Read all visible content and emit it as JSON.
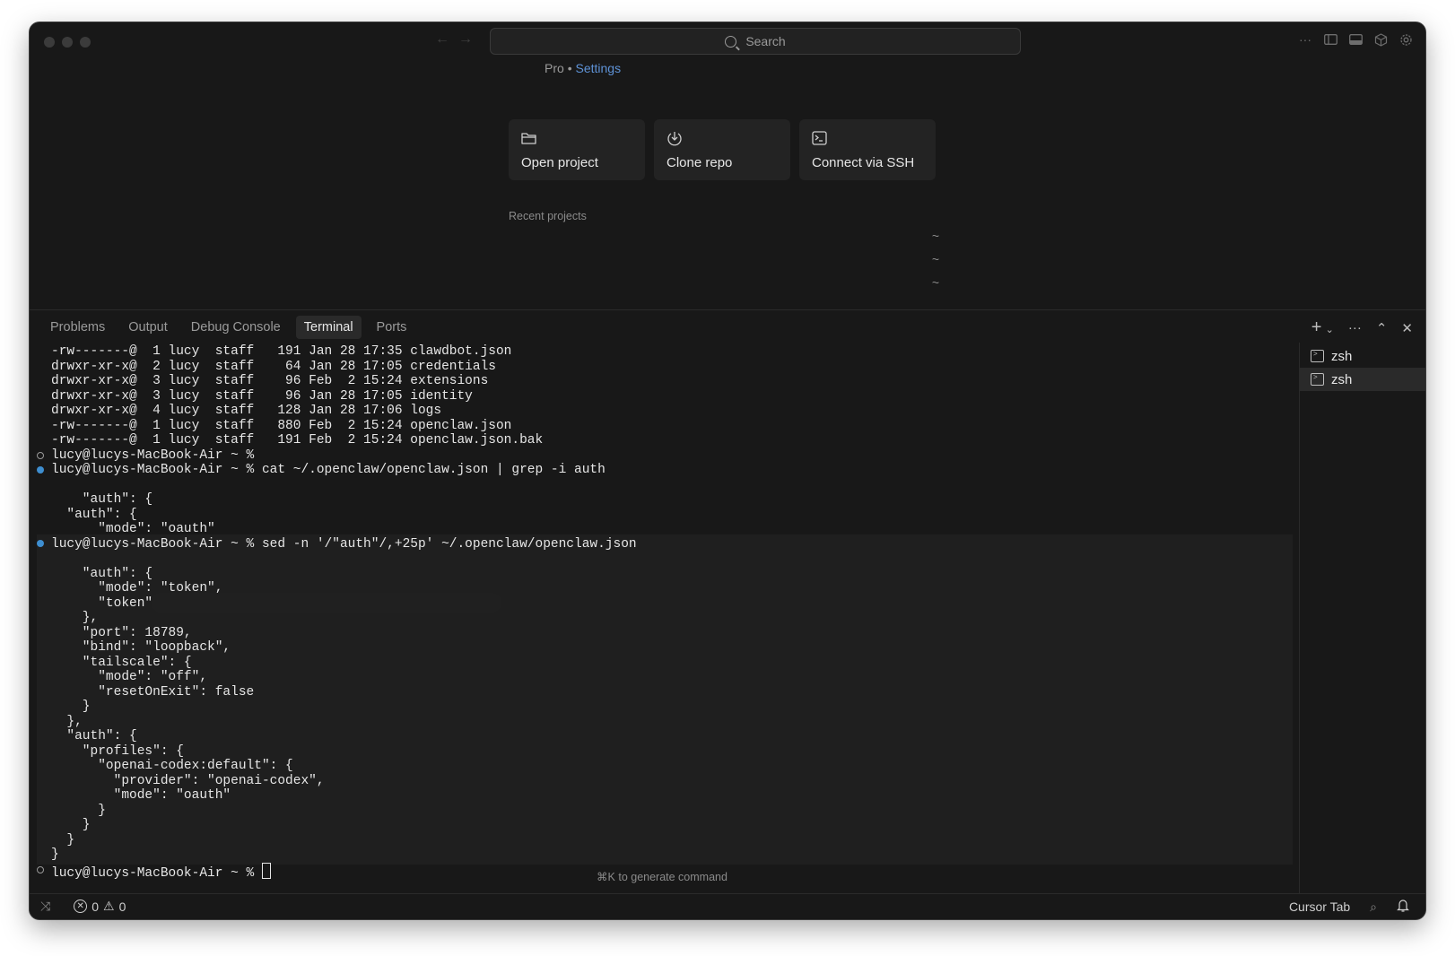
{
  "titlebar": {
    "search_label": "Search"
  },
  "welcome": {
    "plan": "Pro",
    "separator": "•",
    "settings_link": "Settings",
    "cards": [
      {
        "label": "Open project",
        "icon": "folder-icon"
      },
      {
        "label": "Clone repo",
        "icon": "clone-icon"
      },
      {
        "label": "Connect via SSH",
        "icon": "terminal-icon"
      }
    ],
    "recent_label": "Recent projects",
    "recent_items": [
      {
        "path": "~"
      },
      {
        "path": "~"
      },
      {
        "path": "~"
      }
    ]
  },
  "panel": {
    "tabs": [
      "Problems",
      "Output",
      "Debug Console",
      "Terminal",
      "Ports"
    ],
    "active_tab": "Terminal",
    "actions": {
      "add": "+",
      "split": "⌄",
      "more": "···",
      "maximize": "⌃",
      "close": "✕"
    }
  },
  "terminal": {
    "lines": [
      "-rw-------@  1 lucy  staff   191 Jan 28 17:35 clawdbot.json",
      "drwxr-xr-x@  2 lucy  staff    64 Jan 28 17:05 credentials",
      "drwxr-xr-x@  3 lucy  staff    96 Feb  2 15:24 extensions",
      "drwxr-xr-x@  3 lucy  staff    96 Jan 28 17:05 identity",
      "drwxr-xr-x@  4 lucy  staff   128 Jan 28 17:06 logs",
      "-rw-------@  1 lucy  staff   880 Feb  2 15:24 openclaw.json",
      "-rw-------@  1 lucy  staff   191 Feb  2 15:24 openclaw.json.bak",
      "lucy@lucys-MacBook-Air ~ %",
      "lucy@lucys-MacBook-Air ~ % cat ~/.openclaw/openclaw.json | grep -i auth",
      "",
      "    \"auth\": {",
      "  \"auth\": {",
      "      \"mode\": \"oauth\"",
      "lucy@lucys-MacBook-Air ~ % sed -n '/\"auth\"/,+25p' ~/.openclaw/openclaw.json",
      "",
      "    \"auth\": {",
      "      \"mode\": \"token\",",
      "      \"token\":",
      "    },",
      "    \"port\": 18789,",
      "    \"bind\": \"loopback\",",
      "    \"tailscale\": {",
      "      \"mode\": \"off\",",
      "      \"resetOnExit\": false",
      "    }",
      "  },",
      "  \"auth\": {",
      "    \"profiles\": {",
      "      \"openai-codex:default\": {",
      "        \"provider\": \"openai-codex\",",
      "        \"mode\": \"oauth\"",
      "      }",
      "    }",
      "  }",
      "}",
      "lucy@lucys-MacBook-Air ~ %"
    ],
    "hint": "⌘K to generate command"
  },
  "sessions": [
    {
      "label": "zsh"
    },
    {
      "label": "zsh"
    }
  ],
  "statusbar": {
    "errors": "0",
    "warnings": "0",
    "cursor_tab": "Cursor Tab"
  }
}
